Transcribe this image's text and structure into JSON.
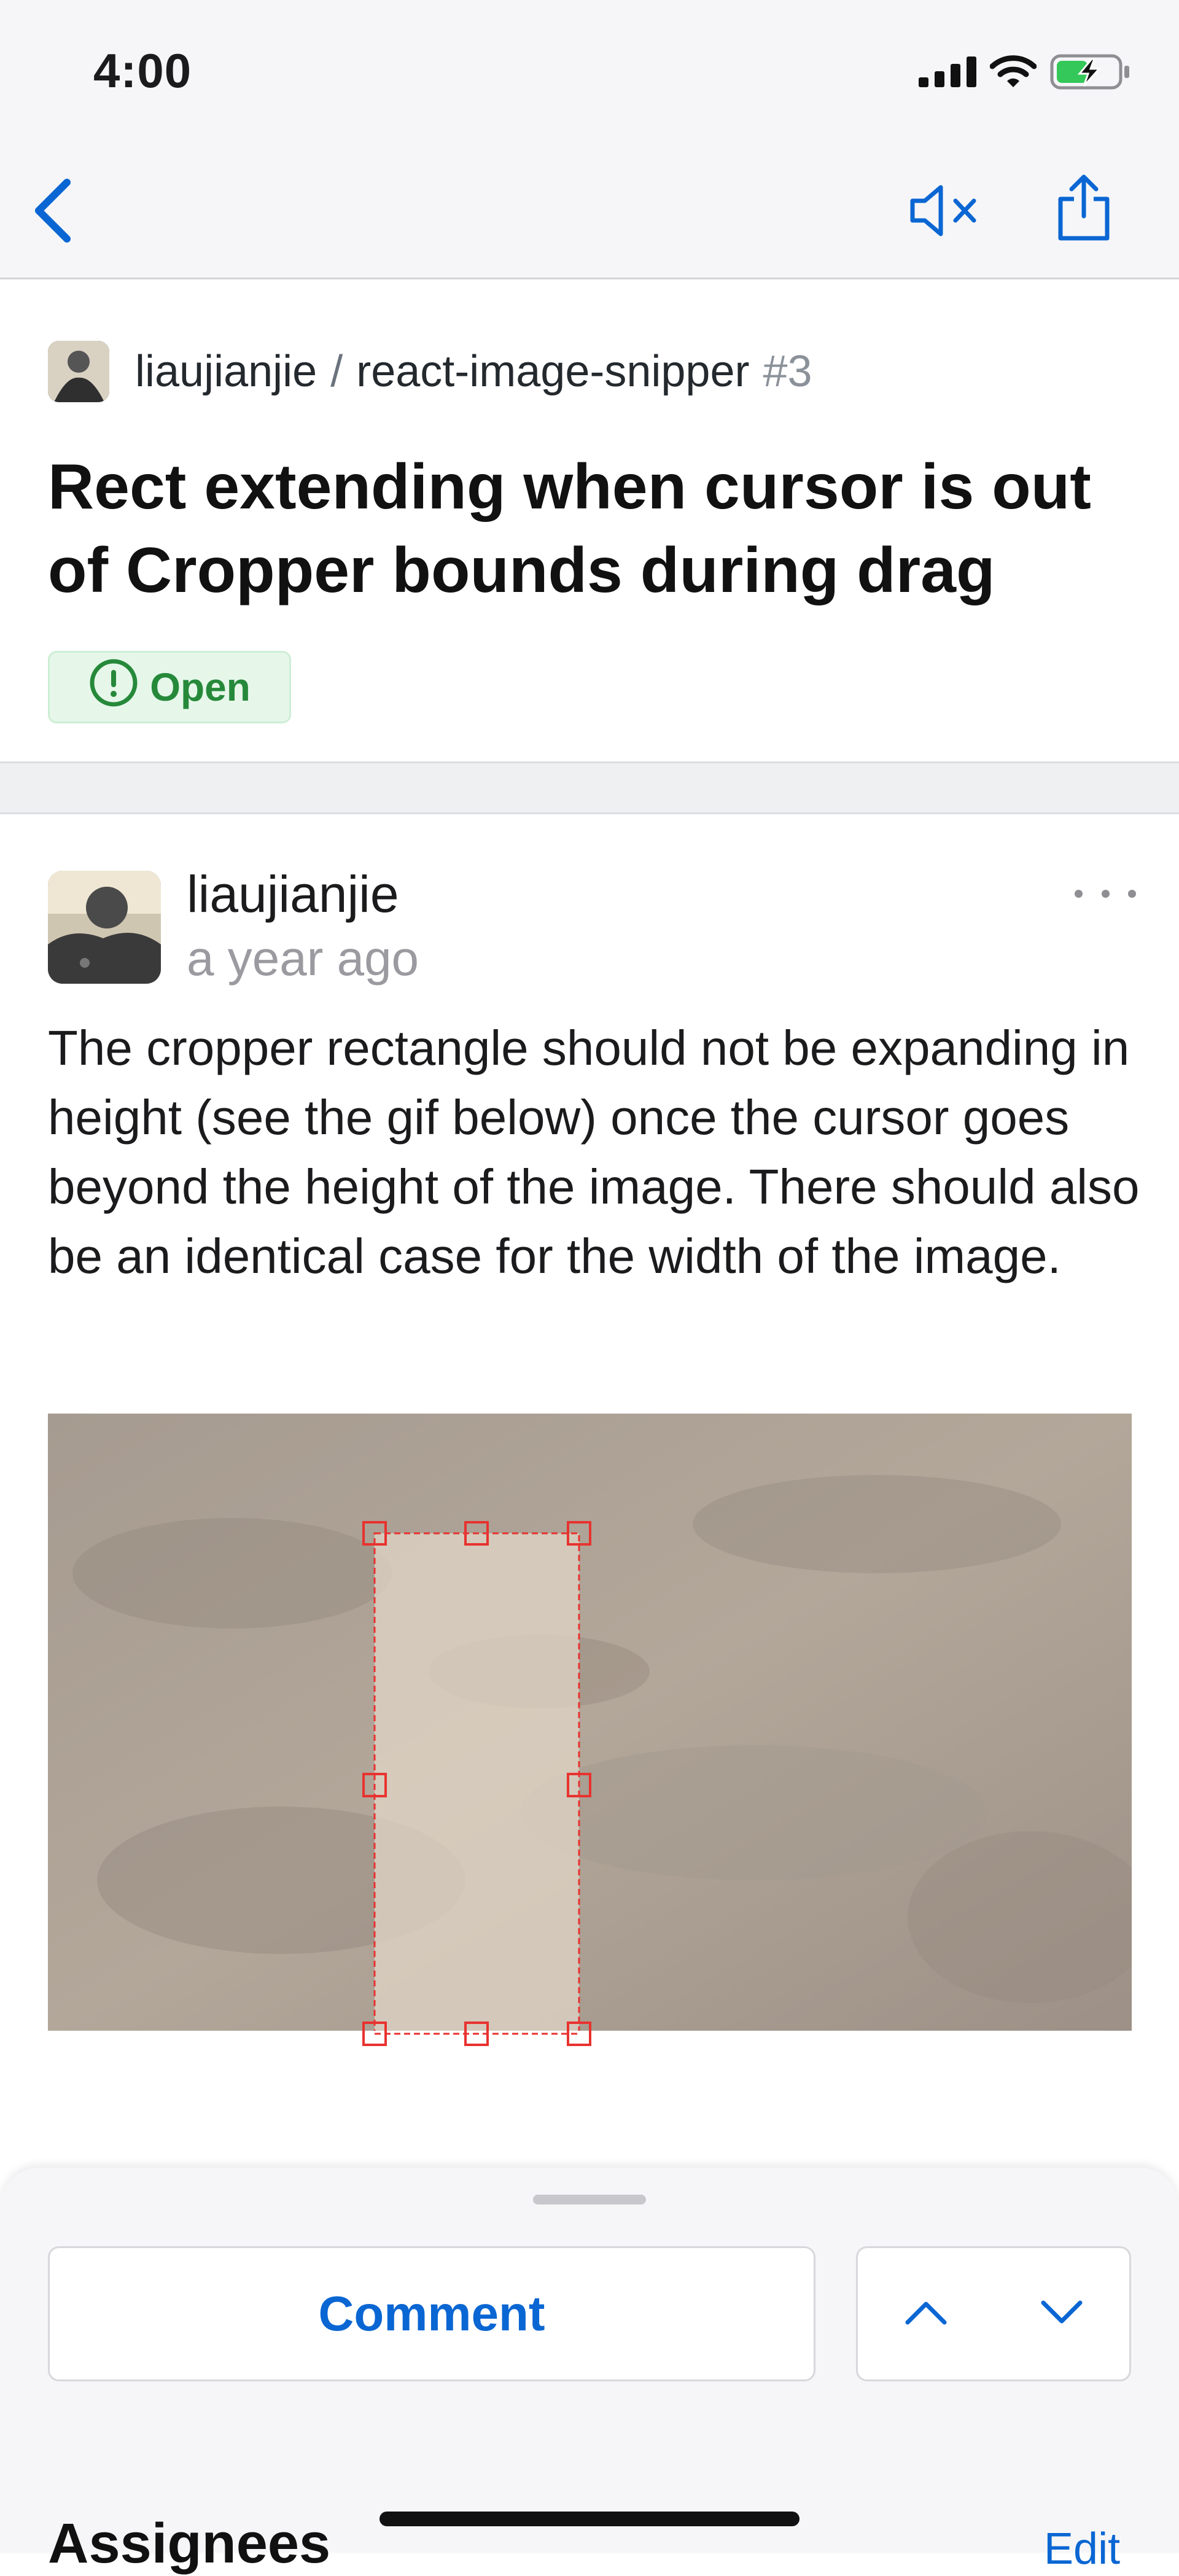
{
  "status_bar": {
    "time": "4:00",
    "battery_state": "charging"
  },
  "nav": {
    "back_icon": "chevron-left-icon",
    "mute_icon": "speaker-mute-icon",
    "share_icon": "share-icon"
  },
  "issue": {
    "owner": "liaujianjie",
    "separator": "/",
    "repo": "react-image-snipper",
    "number": "#3",
    "title": "Rect extending when cursor is out of Cropper bounds during drag",
    "state": "Open"
  },
  "comment": {
    "author": "liaujianjie",
    "time_ago": "a year ago",
    "body": "The cropper rectangle should not be expanding in height (see the gif below) once the cursor goes beyond the height of the image. There should also be an identical case for the width of the image."
  },
  "bottom_sheet": {
    "comment_button": "Comment",
    "assignees_label": "Assignees",
    "edit_label": "Edit"
  },
  "colors": {
    "accent": "#0a66d3",
    "open_green": "#26893a",
    "crop_red": "#e8322f"
  }
}
